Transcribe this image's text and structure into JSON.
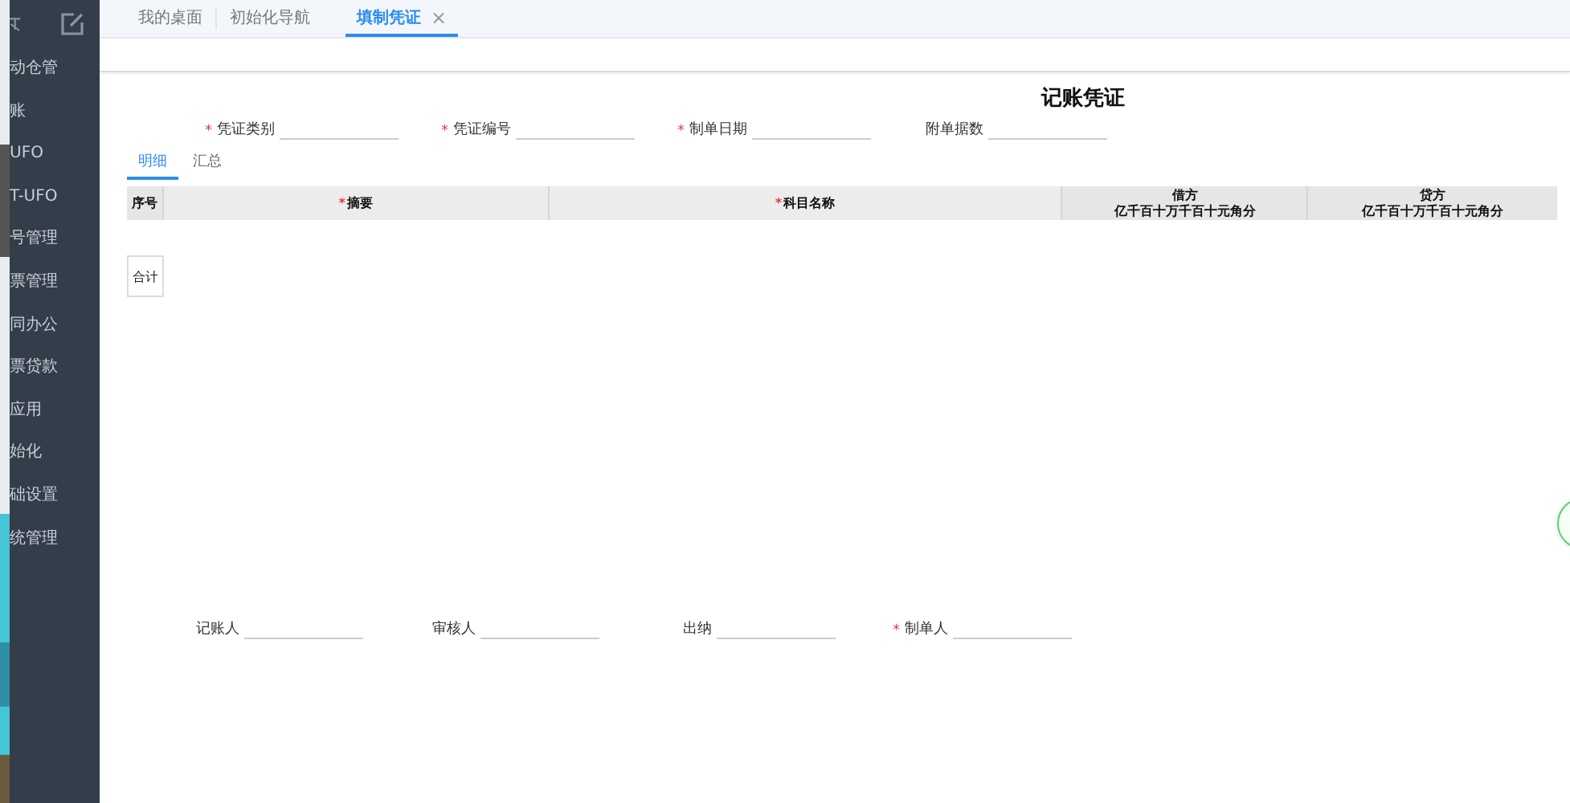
{
  "sidebar": {
    "items": [
      {
        "label": "动仓管"
      },
      {
        "label": "账"
      },
      {
        "label": "UFO"
      },
      {
        "label": "T-UFO"
      },
      {
        "label": "号管理"
      },
      {
        "label": "票管理"
      },
      {
        "label": "同办公"
      },
      {
        "label": "票贷款"
      },
      {
        "label": "应用"
      },
      {
        "label": "始化"
      },
      {
        "label": "础设置"
      },
      {
        "label": "统管理"
      }
    ]
  },
  "tabs": [
    {
      "label": "我的桌面",
      "selected": false,
      "closable": false
    },
    {
      "label": "初始化导航",
      "selected": false,
      "closable": false
    },
    {
      "label": "填制凭证",
      "selected": true,
      "closable": true
    }
  ],
  "close_glyph": "×",
  "voucher": {
    "title": "记账凭证",
    "header_fields": [
      {
        "label": "凭证类别",
        "required": true
      },
      {
        "label": "凭证编号",
        "required": true
      },
      {
        "label": "制单日期",
        "required": true
      },
      {
        "label": "附单据数",
        "required": false
      }
    ],
    "subtabs": [
      {
        "label": "明细",
        "selected": true
      },
      {
        "label": "汇总",
        "selected": false
      }
    ],
    "table": {
      "columns": [
        {
          "title": "序号",
          "required": false
        },
        {
          "title": "摘要",
          "required": true
        },
        {
          "title": "科目名称",
          "required": true
        },
        {
          "title": "借方",
          "sub": "亿千百十万千百十元角分",
          "required": false
        },
        {
          "title": "贷方",
          "sub": "亿千百十万千百十元角分",
          "required": false
        }
      ],
      "total_button": "合计"
    },
    "footer_fields": [
      {
        "label": "记账人",
        "required": false
      },
      {
        "label": "审核人",
        "required": false
      },
      {
        "label": "出纳",
        "required": false
      },
      {
        "label": "制单人",
        "required": true
      }
    ]
  },
  "required_mark": "*"
}
